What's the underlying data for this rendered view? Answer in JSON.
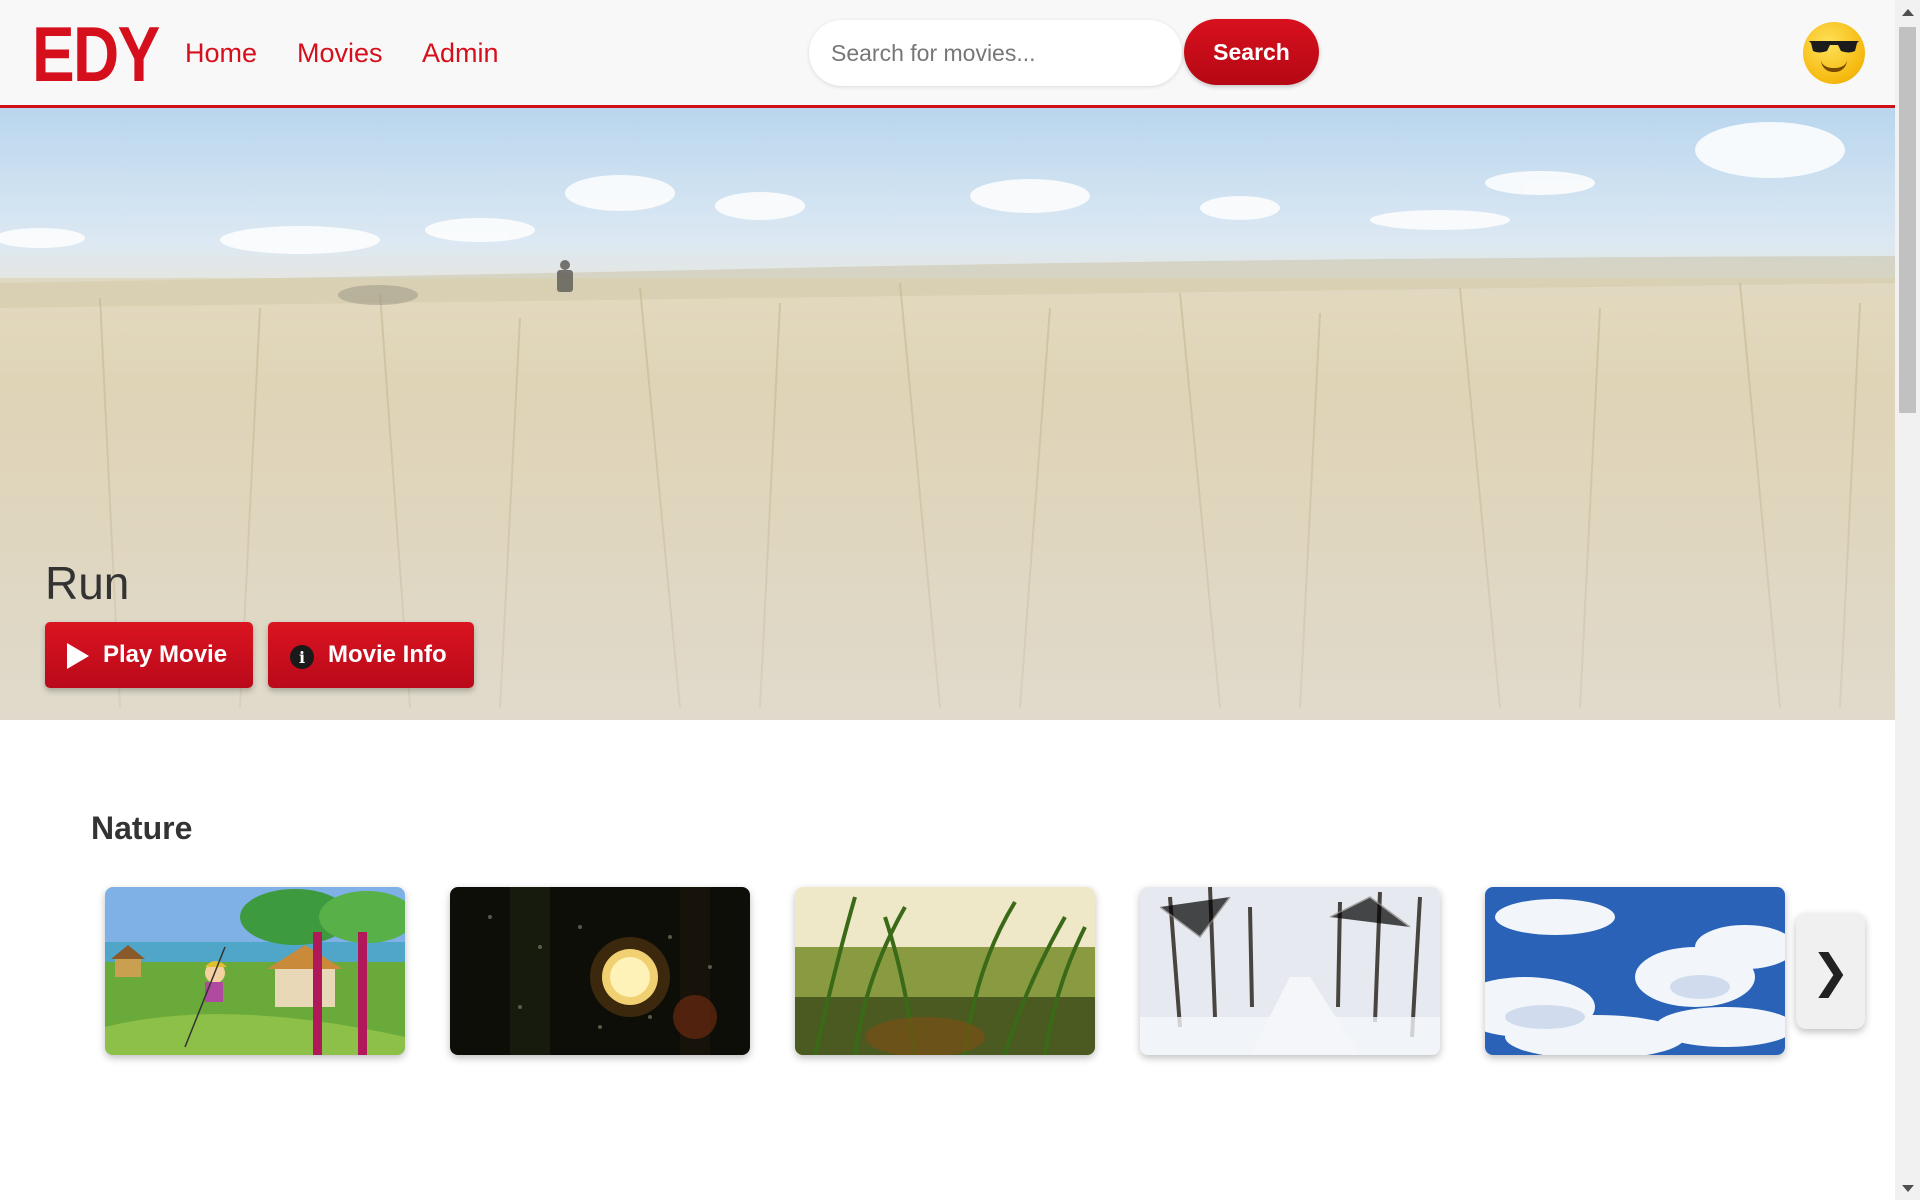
{
  "header": {
    "logo": "EDY",
    "nav": [
      "Home",
      "Movies",
      "Admin"
    ],
    "search_placeholder": "Search for movies...",
    "search_label": "Search",
    "avatar_icon": "sunglasses-emoji-icon"
  },
  "hero": {
    "title": "Run",
    "play_label": "Play Movie",
    "info_label": "Movie Info",
    "play_icon": "play-icon",
    "info_icon": "info-icon"
  },
  "section": {
    "title": "Nature",
    "cards": [
      "cartoon-swing",
      "rain-night-light",
      "grass-closeup",
      "snowy-road",
      "blue-sky-clouds"
    ],
    "next_icon": "chevron-right-icon",
    "next_glyph": "❯"
  },
  "colors": {
    "brand": "#d60f1c",
    "header_bg": "#f8f8f8",
    "text_dark": "#333333"
  }
}
